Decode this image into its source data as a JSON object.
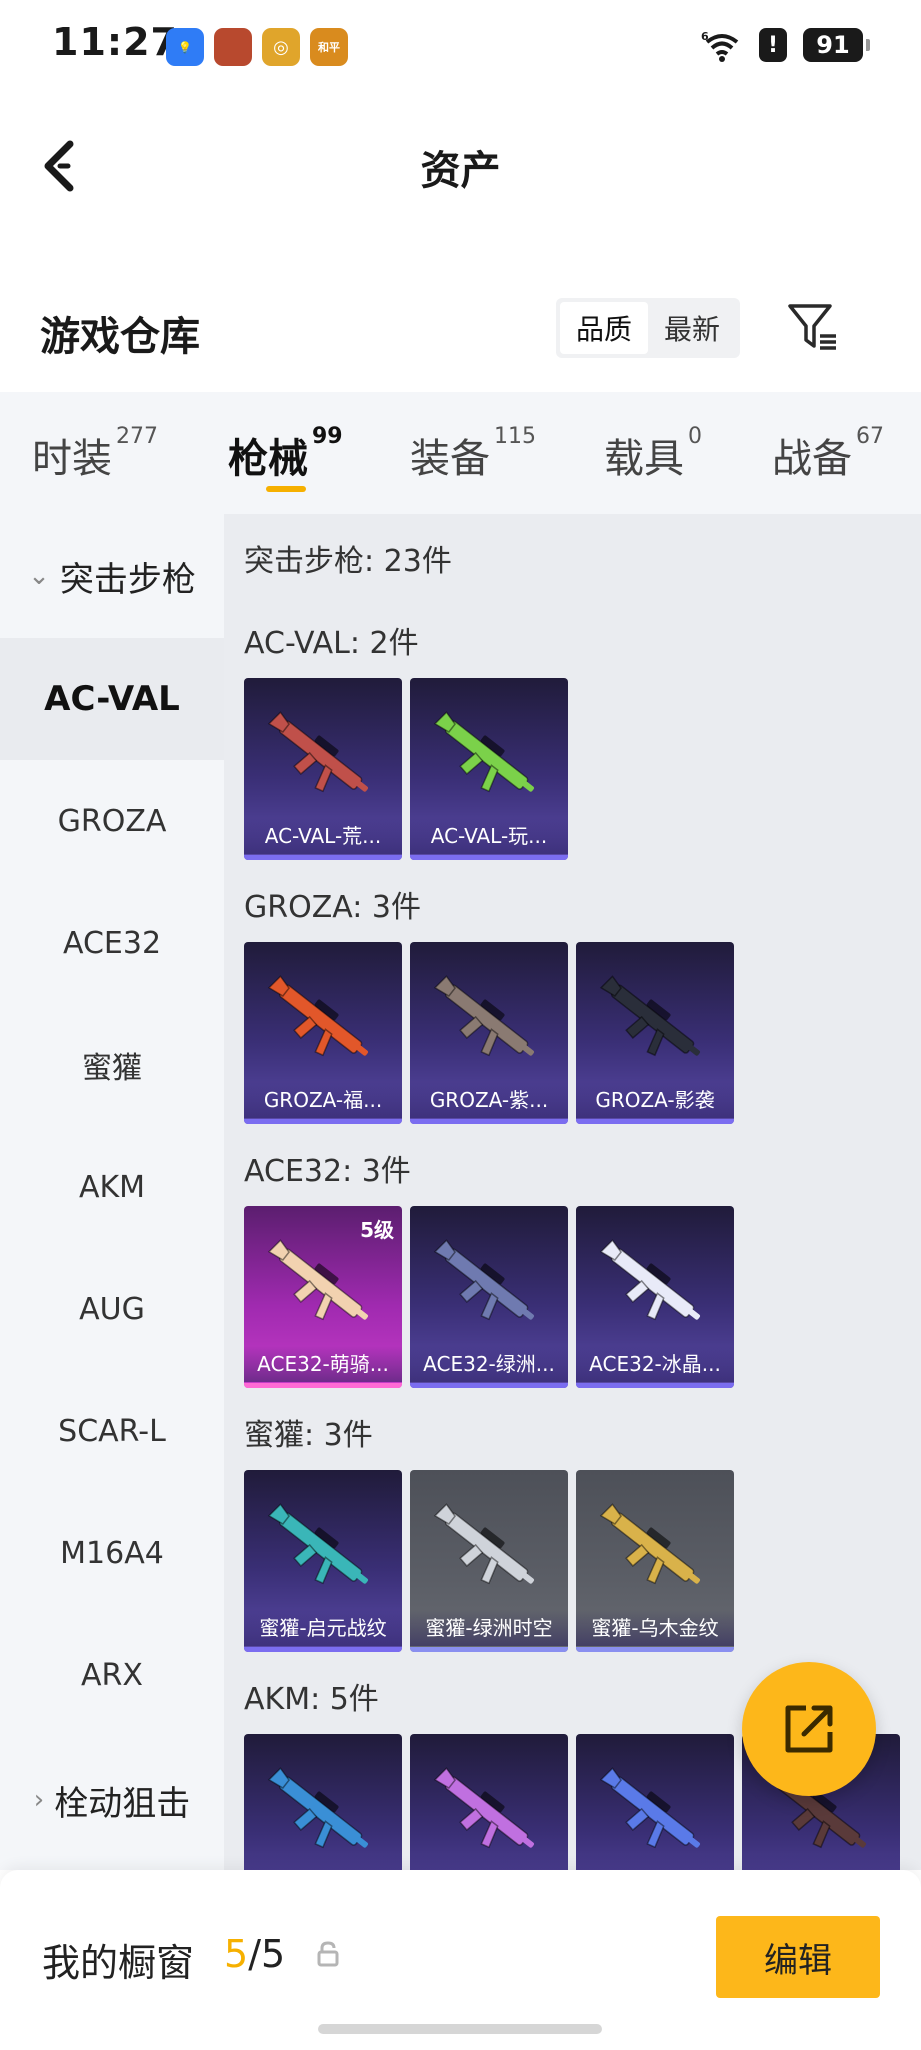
{
  "status_bar": {
    "time": "11:27",
    "apps": [
      {
        "icon": "bulb-app-icon",
        "glyph": "💡",
        "color": "#2f7cf6"
      },
      {
        "icon": "game-avatar-app-icon",
        "glyph": "",
        "color": "#b8492e"
      },
      {
        "icon": "target-app-icon",
        "glyph": "◎",
        "color": "#e0a52b"
      },
      {
        "icon": "peace-elite-app-icon",
        "glyph": "和平",
        "color": "#d98b1e"
      }
    ],
    "alert": "!",
    "battery": "91"
  },
  "header": {
    "title": "资产"
  },
  "warehouse": {
    "title": "游戏仓库",
    "sort_options": [
      "品质",
      "最新"
    ],
    "active_sort": 0
  },
  "tabs": [
    {
      "label": "时装",
      "count": "277"
    },
    {
      "label": "枪械",
      "count": "99"
    },
    {
      "label": "装备",
      "count": "115"
    },
    {
      "label": "载具",
      "count": "0"
    },
    {
      "label": "战备",
      "count": "67"
    }
  ],
  "sidebar": {
    "groups": [
      {
        "label": "突击步枪",
        "chevron": "⌄"
      },
      {
        "label": "栓动狙击",
        "chevron": "›"
      }
    ],
    "items": [
      "AC-VAL",
      "GROZA",
      "ACE32",
      "蜜獾",
      "AKM",
      "AUG",
      "SCAR-L",
      "M16A4",
      "ARX"
    ]
  },
  "content": {
    "category_title": "突击步枪: 23件",
    "sections": [
      {
        "title": "AC-VAL: 2件",
        "items": [
          {
            "label": "AC-VAL-荒...",
            "style": "purple",
            "gun_color": "#c0504a"
          },
          {
            "label": "AC-VAL-玩...",
            "style": "purple",
            "gun_color": "#7bd14a"
          }
        ]
      },
      {
        "title": "GROZA: 3件",
        "items": [
          {
            "label": "GROZA-福...",
            "style": "purple",
            "gun_color": "#e2572a"
          },
          {
            "label": "GROZA-紫...",
            "style": "purple",
            "gun_color": "#8a7a72"
          },
          {
            "label": "GROZA-影袭",
            "style": "purple",
            "gun_color": "#2a2e3a"
          }
        ]
      },
      {
        "title": "ACE32: 3件",
        "items": [
          {
            "label": "ACE32-萌骑...",
            "style": "pink",
            "gun_color": "#f2d2b0",
            "badge": "5级"
          },
          {
            "label": "ACE32-绿洲...",
            "style": "purple",
            "gun_color": "#6f7ab0"
          },
          {
            "label": "ACE32-冰晶...",
            "style": "purple",
            "gun_color": "#e8eaf8"
          }
        ]
      },
      {
        "title": "蜜獾: 3件",
        "items": [
          {
            "label": "蜜獾-启元战纹",
            "style": "purple",
            "gun_color": "#3ab6b8"
          },
          {
            "label": "蜜獾-绿洲时空",
            "style": "gray",
            "gun_color": "#cfd3da"
          },
          {
            "label": "蜜獾-乌木金纹",
            "style": "gray",
            "gun_color": "#d9b24a"
          }
        ]
      },
      {
        "title": "AKM: 5件",
        "items": [
          {
            "label": "",
            "style": "purple",
            "gun_color": "#3a8fd6"
          },
          {
            "label": "",
            "style": "purple",
            "gun_color": "#c070e0"
          },
          {
            "label": "",
            "style": "purple",
            "gun_color": "#5a7ae8"
          },
          {
            "label": "",
            "style": "purple",
            "gun_color": "#5a3a3a"
          }
        ]
      }
    ]
  },
  "showcase": {
    "title": "我的橱窗",
    "used": "5",
    "separator": "/",
    "total": "5",
    "edit_label": "编辑"
  },
  "colors": {
    "accent": "#fdb71a",
    "tab_indicator": "#f6b000",
    "card_purple": "#3a2f76",
    "card_gray": "#5b5e66",
    "card_pink": "#a02ab0"
  }
}
